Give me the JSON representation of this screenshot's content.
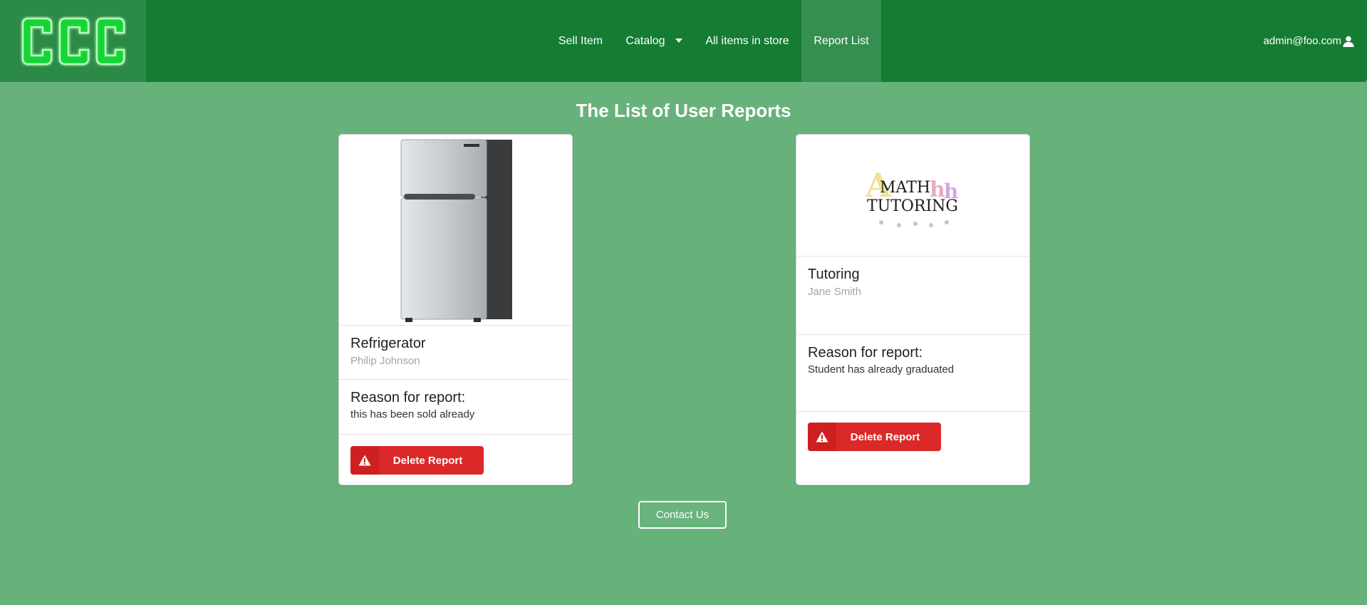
{
  "nav": {
    "logo_text": "CCC",
    "items": [
      {
        "label": "Sell Item"
      },
      {
        "label": "Catalog"
      },
      {
        "label": "All items in store"
      },
      {
        "label": "Report List"
      }
    ],
    "user_email": "admin@foo.com",
    "user_icon": "user-icon",
    "dropdown_icon": "caret-down-icon"
  },
  "page_title": "The List of User Reports",
  "reports": [
    {
      "item_name": "Refrigerator",
      "seller": "Philip Johnson",
      "reason_label": "Reason for report:",
      "reason": "this has been sold already",
      "delete_label": "Delete Report",
      "image_icon": "refrigerator-image"
    },
    {
      "item_name": "Tutoring",
      "seller": "Jane Smith",
      "reason_label": "Reason for report:",
      "reason": "Student has already graduated",
      "delete_label": "Delete Report",
      "image_icon": "math-tutoring-image",
      "image_text_line1": "MATH",
      "image_text_line2": "TUTORING"
    }
  ],
  "contact_label": "Contact Us",
  "colors": {
    "background": "#67b27b",
    "navbar": "#147d33",
    "active_nav": "#348f50",
    "danger": "#db2828"
  }
}
